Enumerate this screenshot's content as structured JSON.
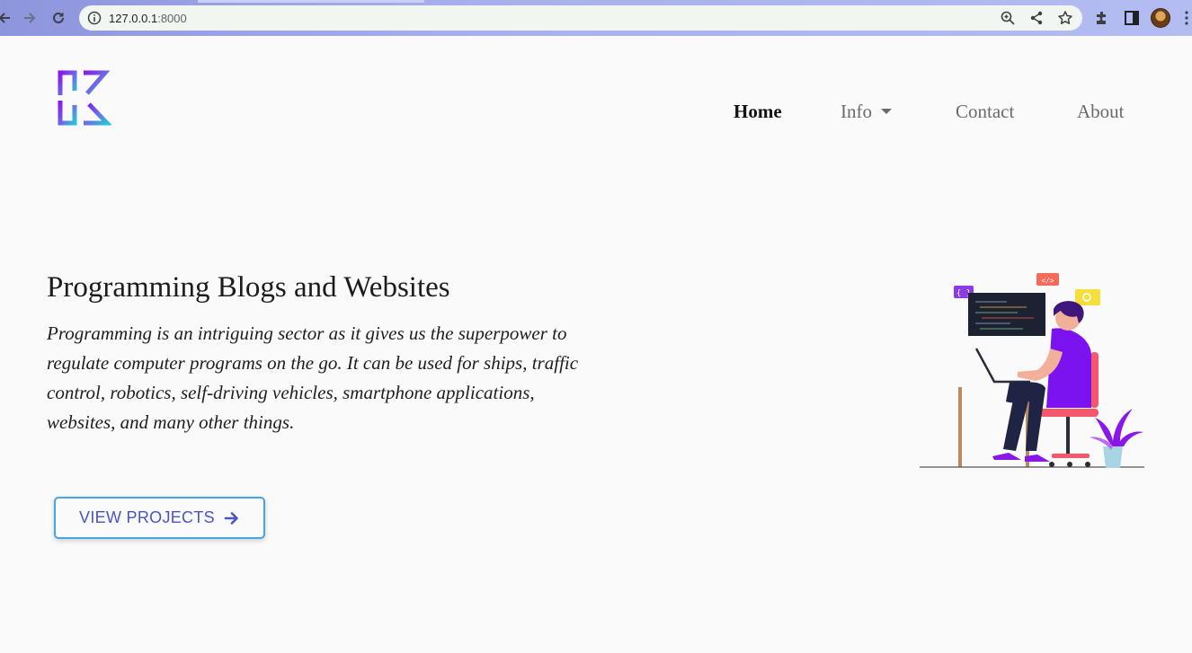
{
  "browser": {
    "url_host": "127.0.0.1",
    "url_port": ":8000",
    "icons": [
      "back-icon",
      "forward-icon",
      "reload-icon",
      "info-icon",
      "zoom-icon",
      "share-icon",
      "star-icon",
      "extensions-icon",
      "side-panel-icon",
      "profile-avatar",
      "menu-icon"
    ]
  },
  "nav": {
    "items": [
      {
        "label": "Home",
        "active": true
      },
      {
        "label": "Info",
        "dropdown": true
      },
      {
        "label": "Contact"
      },
      {
        "label": "About"
      }
    ]
  },
  "hero": {
    "title": "Programming Blogs and Websites",
    "text": "Programming is an intriguing sector as it gives us the superpower to regulate computer programs on the go. It can be used for ships, traffic control, robotics, self-driving vehicles, smartphone applications, websites, and many other things.",
    "cta_label": "VIEW PROJECTS"
  },
  "illustration": {
    "code_bubble_text": "</>",
    "brace_bubble_text": "{ }"
  },
  "colors": {
    "accent": "#4a54c9",
    "button_border": "#4aa3e4",
    "logo_purple": "#8a2be2",
    "logo_cyan": "#2bb8d8",
    "shirt": "#7b12f0"
  }
}
